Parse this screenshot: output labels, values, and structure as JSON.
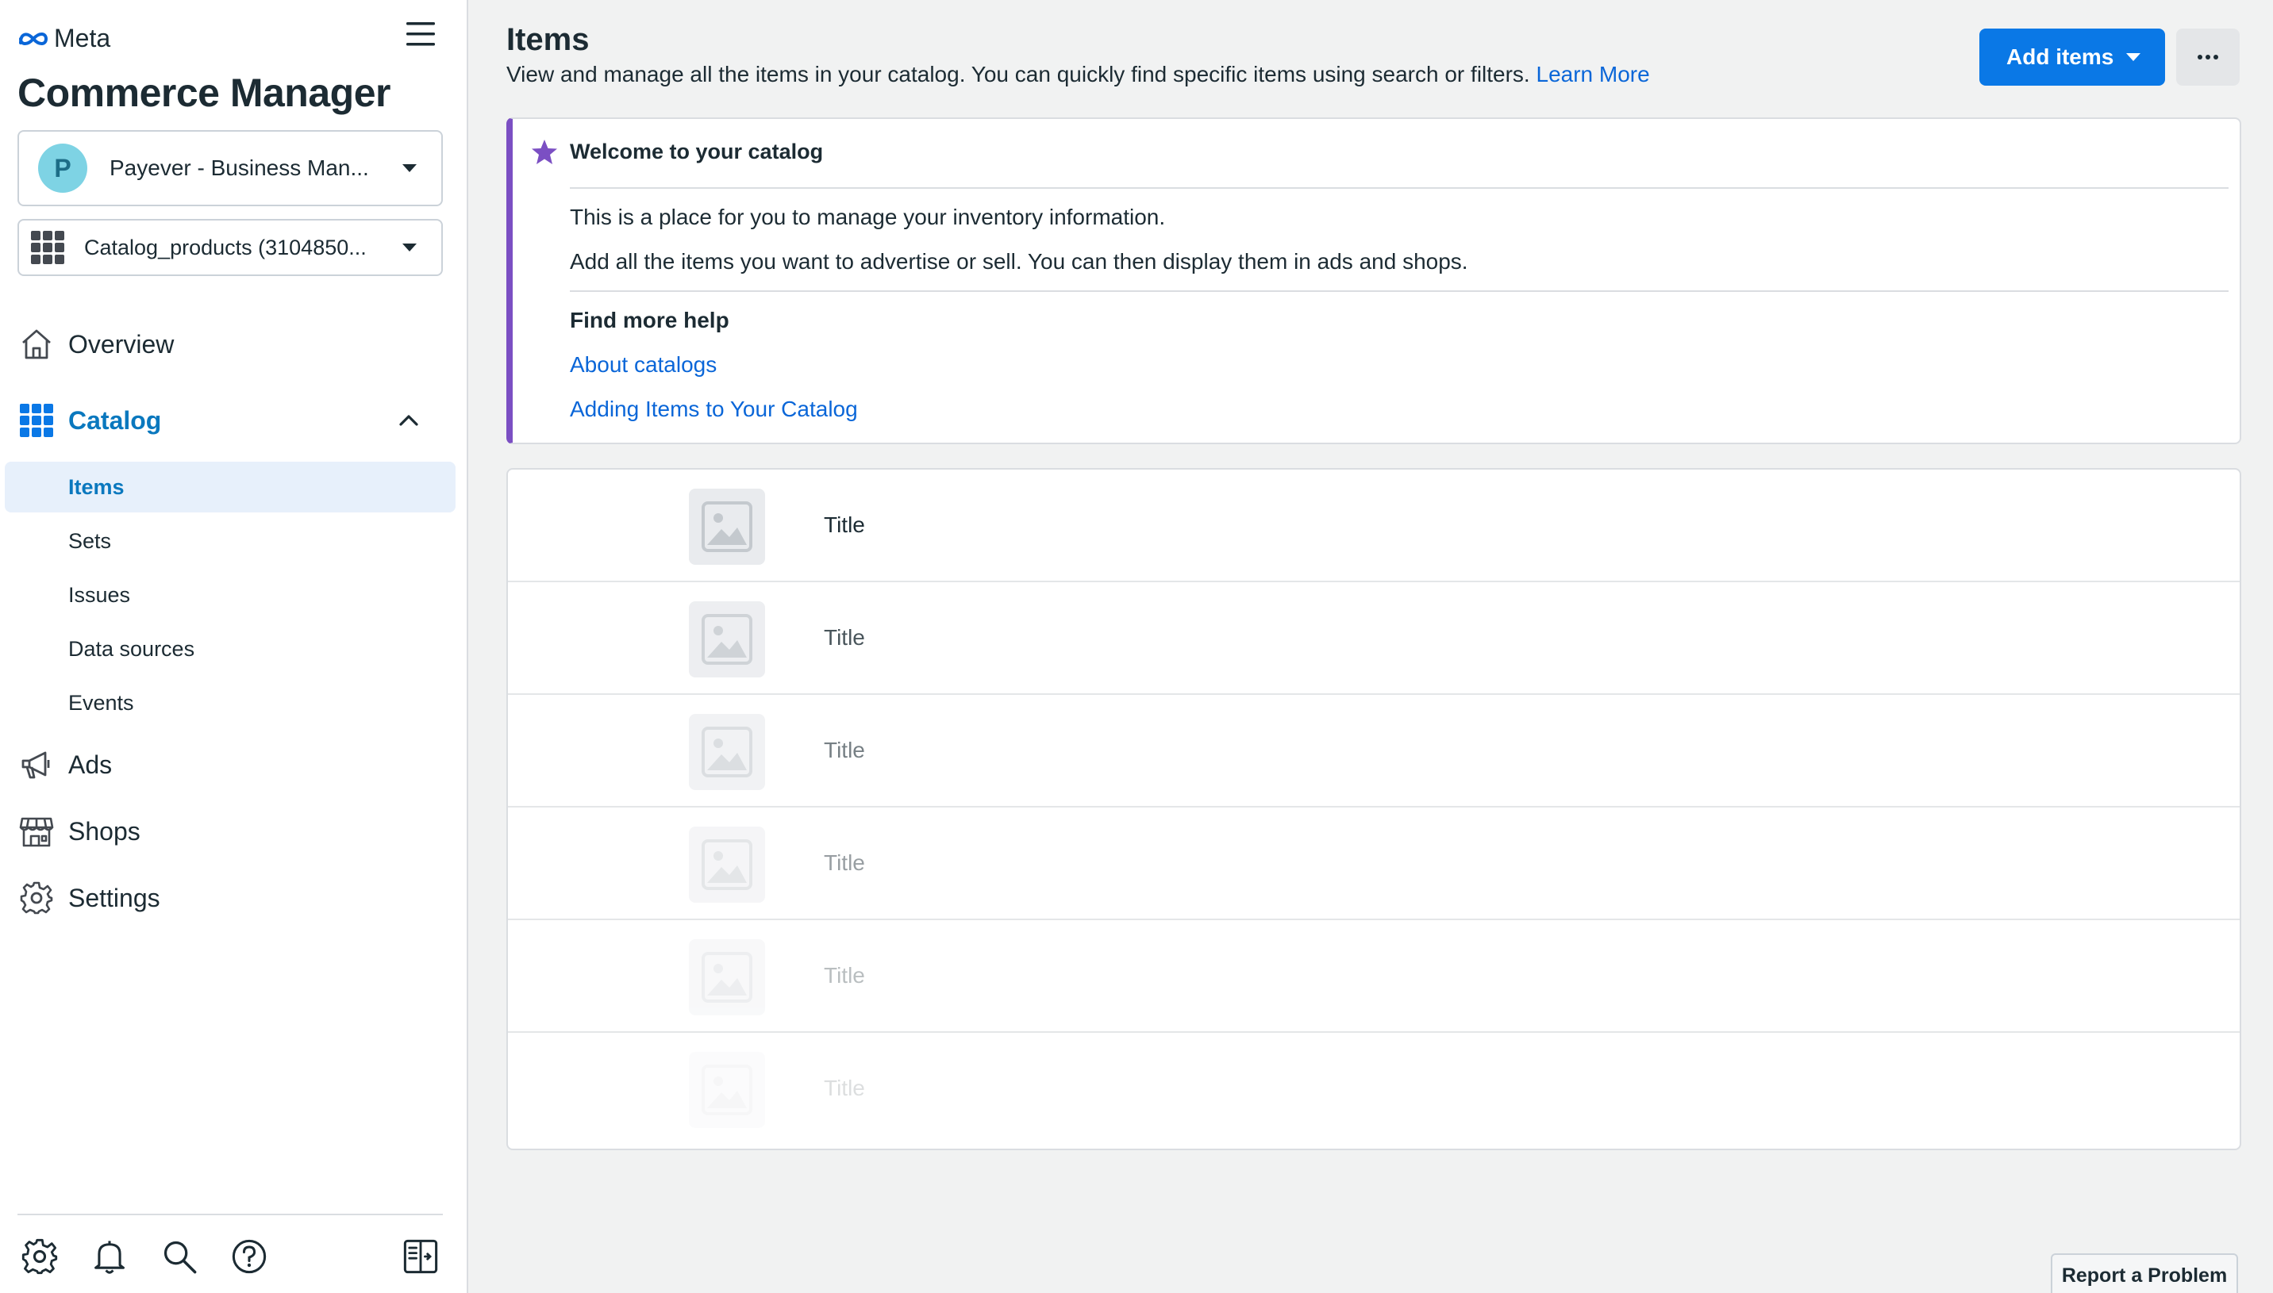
{
  "sidebar": {
    "brand": "Meta",
    "app_title": "Commerce Manager",
    "business_selector": {
      "avatar_letter": "P",
      "label": "Payever - Business Man..."
    },
    "catalog_selector": {
      "label": "Catalog_products (3104850..."
    },
    "nav": {
      "overview": "Overview",
      "catalog": "Catalog",
      "ads": "Ads",
      "shops": "Shops",
      "settings": "Settings"
    },
    "catalog_sub": {
      "items": "Items",
      "sets": "Sets",
      "issues": "Issues",
      "data_sources": "Data sources",
      "events": "Events"
    },
    "footer_icons": [
      "gear-icon",
      "bell-icon",
      "search-icon",
      "help-icon",
      "panel-toggle-icon"
    ]
  },
  "header": {
    "title": "Items",
    "description": "View and manage all the items in your catalog. You can quickly find specific items using search or filters.",
    "learn_more": "Learn More",
    "add_items_label": "Add items",
    "more_label": "···"
  },
  "welcome": {
    "title": "Welcome to your catalog",
    "line1": "This is a place for you to manage your inventory information.",
    "line2": "Add all the items you want to advertise or sell. You can then display them in ads and shops.",
    "help_heading": "Find more help",
    "link1": "About catalogs",
    "link2": "Adding Items to Your Catalog"
  },
  "items": [
    {
      "title": "Title",
      "fade": 1.0
    },
    {
      "title": "Title",
      "fade": 0.8
    },
    {
      "title": "Title",
      "fade": 0.6
    },
    {
      "title": "Title",
      "fade": 0.45
    },
    {
      "title": "Title",
      "fade": 0.3
    },
    {
      "title": "Title",
      "fade": 0.15
    }
  ],
  "report_problem": "Report a Problem",
  "colors": {
    "accent": "#0a78e6",
    "link": "#0a66d8",
    "active_nav": "#0a78be",
    "welcome_border": "#7b4fc3",
    "avatar_bg": "#7ed3e4"
  }
}
